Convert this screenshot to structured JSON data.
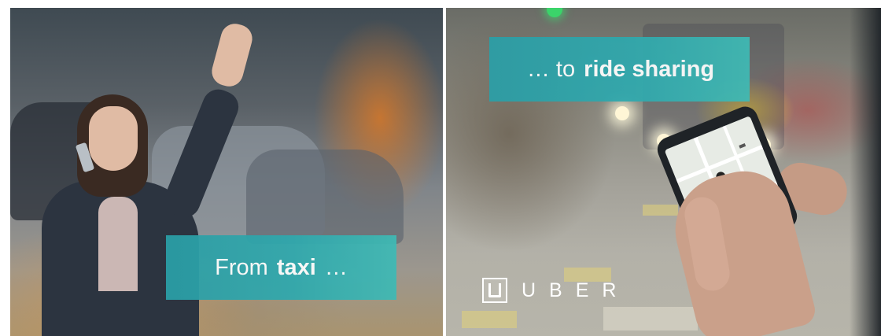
{
  "left_panel": {
    "caption": {
      "prefix": "From ",
      "bold": "taxi",
      "suffix": " …"
    }
  },
  "right_panel": {
    "caption": {
      "prefix": "… to ",
      "bold": "ride sharing"
    },
    "logo": {
      "text": "UBER",
      "icon": "uber-logo-box-icon"
    }
  },
  "colors": {
    "caption_background": "#2fa9ae",
    "caption_text": "#ffffff",
    "logo": "#ffffff"
  }
}
